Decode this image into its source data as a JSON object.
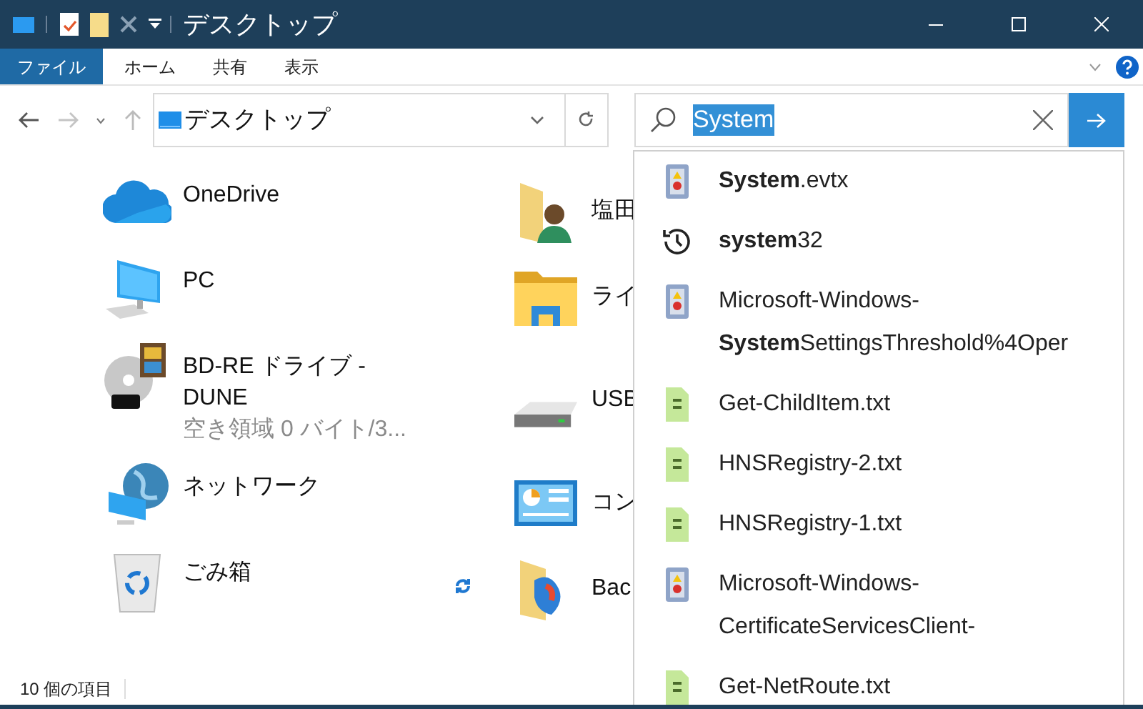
{
  "window": {
    "title": "デスクトップ"
  },
  "ribbon_tabs": [
    {
      "label": "ファイル",
      "selected": true
    },
    {
      "label": "ホーム",
      "selected": false
    },
    {
      "label": "共有",
      "selected": false
    },
    {
      "label": "表示",
      "selected": false
    }
  ],
  "address_bar": {
    "location": "デスクトップ"
  },
  "search": {
    "value": "System"
  },
  "items_left": [
    {
      "kind": "onedrive",
      "lines": [
        "OneDrive"
      ]
    },
    {
      "kind": "pc",
      "lines": [
        "PC"
      ]
    },
    {
      "kind": "disc",
      "lines": [
        "BD-RE ドライブ -",
        "DUNE"
      ],
      "detail": "空き領域 0 バイト/3..."
    },
    {
      "kind": "network",
      "lines": [
        "ネットワーク"
      ]
    },
    {
      "kind": "recycle",
      "lines": [
        "ごみ箱"
      ]
    }
  ],
  "items_right": [
    {
      "kind": "user-folder",
      "lines": [
        "塩田"
      ]
    },
    {
      "kind": "library",
      "lines": [
        "ライ"
      ]
    },
    {
      "kind": "drive",
      "lines": [
        "USB"
      ]
    },
    {
      "kind": "control-panel",
      "lines": [
        "コン"
      ]
    },
    {
      "kind": "backup-folder",
      "lines": [
        "Bac"
      ],
      "syncing": true
    }
  ],
  "suggestions": [
    {
      "kind": "event-log",
      "lines": [
        "**System**.evtx"
      ]
    },
    {
      "kind": "history",
      "lines": [
        "**system**32"
      ]
    },
    {
      "kind": "event-log",
      "lines": [
        "Microsoft-Windows-",
        "**System**SettingsThreshold%4Oper"
      ]
    },
    {
      "kind": "text-file",
      "lines": [
        "Get-ChildItem.txt"
      ]
    },
    {
      "kind": "text-file",
      "lines": [
        "HNSRegistry-2.txt"
      ]
    },
    {
      "kind": "text-file",
      "lines": [
        "HNSRegistry-1.txt"
      ]
    },
    {
      "kind": "event-log",
      "lines": [
        "Microsoft-Windows-",
        "CertificateServicesClient-"
      ]
    },
    {
      "kind": "text-file",
      "lines": [
        "Get-NetRoute.txt"
      ]
    }
  ],
  "status_bar": {
    "count": "10 個の項目"
  }
}
